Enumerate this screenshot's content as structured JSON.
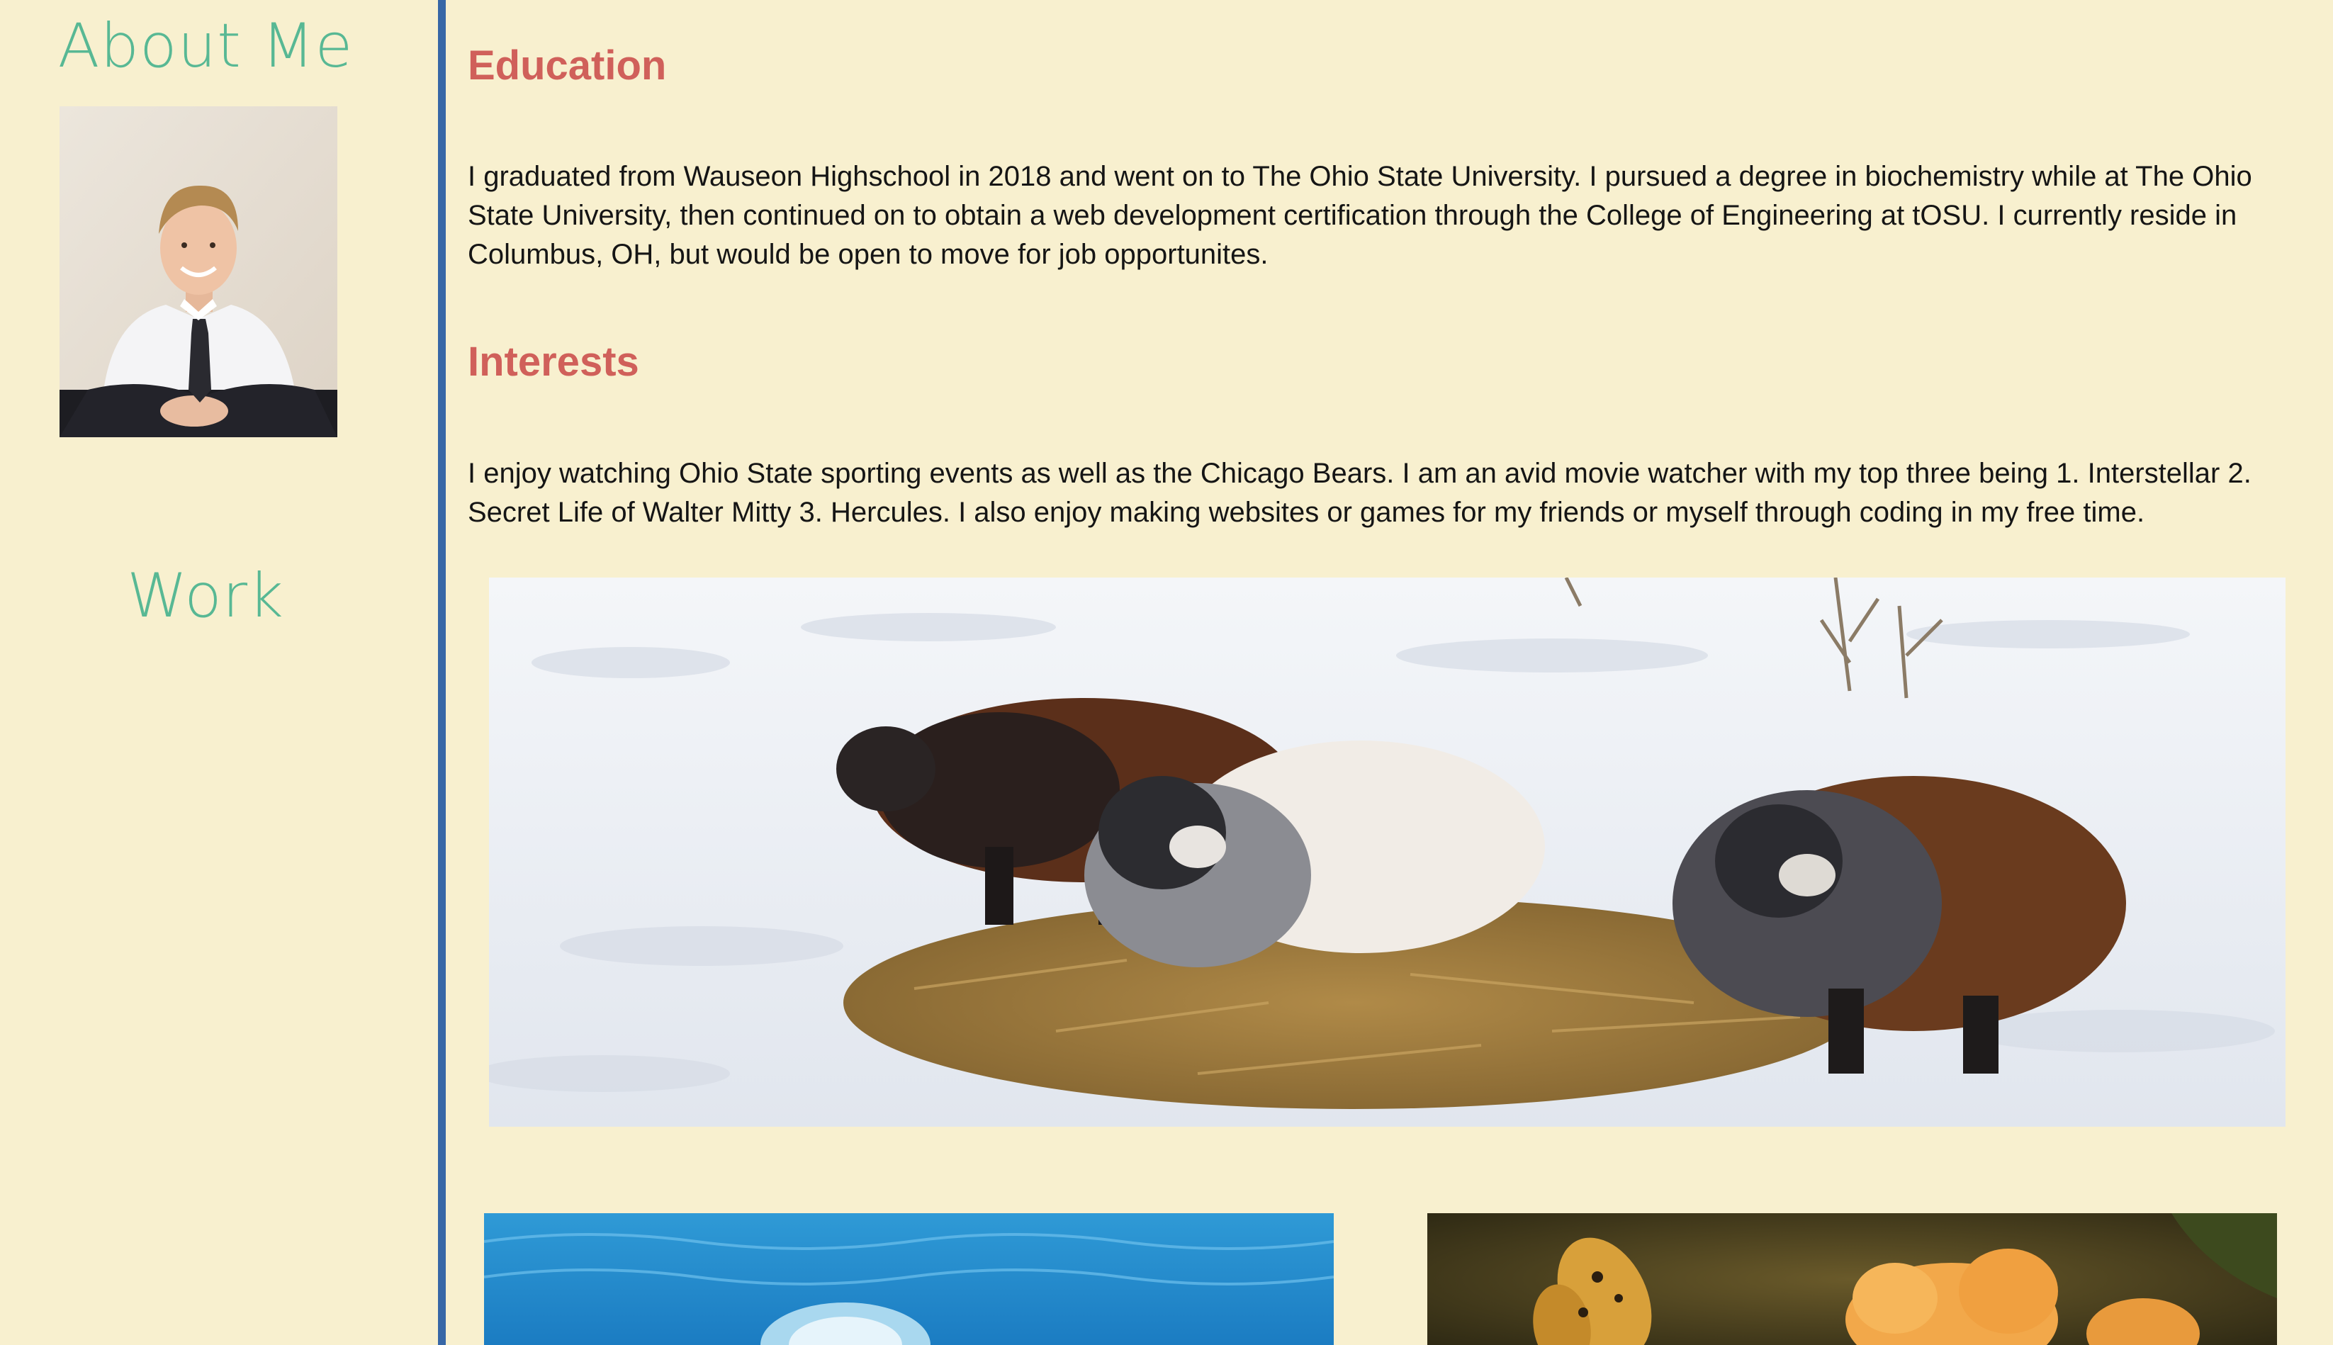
{
  "sidebar": {
    "about_title": "About Me",
    "work_title": "Work"
  },
  "education": {
    "heading": "Education",
    "text": "I graduated from Wauseon Highschool in 2018 and went on to The Ohio State University. I pursued a degree in biochemistry while at The Ohio State University, then continued on to obtain a web development certification through the College of Engineering at tOSU. I currently reside in Columbus, OH, but would be open to move for job opportunites."
  },
  "interests": {
    "heading": "Interests",
    "text": "I enjoy watching Ohio State sporting events as well as the Chicago Bears. I am an avid movie watcher with my top three being 1. Interstellar 2. Secret Life of Walter Mitty 3. Hercules. I also enjoy making websites or games for my friends or myself through coding in my free time."
  },
  "colors": {
    "background": "#f8f0cf",
    "sidebar_title": "#58b894",
    "heading": "#d0605a",
    "divider": "#3867a6"
  }
}
